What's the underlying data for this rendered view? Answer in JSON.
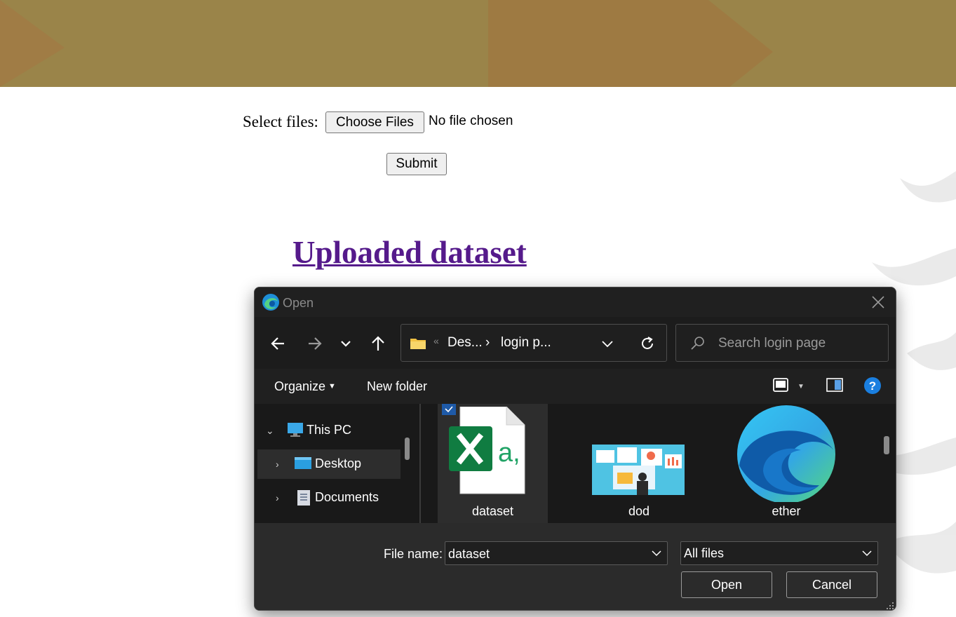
{
  "page": {
    "select_label": "Select files:",
    "choose_button": "Choose Files",
    "no_file_text": "No file chosen",
    "submit_button": "Submit",
    "uploaded_link": "Uploaded dataset"
  },
  "dialog": {
    "title": "Open",
    "address": {
      "overflow_marker": "«",
      "segments": [
        "Des...",
        "login p..."
      ],
      "separator": "›"
    },
    "search_placeholder": "Search login page",
    "commands": {
      "organize": "Organize",
      "new_folder": "New folder"
    },
    "tree": [
      {
        "label": "This PC",
        "expanded": true
      },
      {
        "label": "Desktop",
        "selected": true
      },
      {
        "label": "Documents"
      }
    ],
    "files": [
      {
        "name": "dataset",
        "icon": "excel-csv-file-icon",
        "selected": true
      },
      {
        "name": "dod",
        "icon": "image-thumbnail-icon"
      },
      {
        "name": "ether",
        "icon": "edge-logo-icon"
      }
    ],
    "file_name_label": "File name:",
    "file_name_value": "dataset",
    "file_type": "All files",
    "open_button": "Open",
    "cancel_button": "Cancel"
  },
  "colors": {
    "banner": "#9a8449",
    "link": "#551a8b",
    "dialog_bg": "#202020",
    "accent": "#0078d4"
  }
}
